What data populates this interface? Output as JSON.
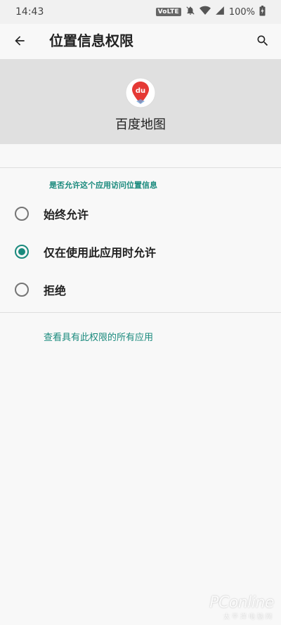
{
  "status_bar": {
    "time": "14:43",
    "network_badge": "VoLTE",
    "battery_percent": "100%",
    "icons": [
      "mute-icon",
      "wifi-icon",
      "signal-icon",
      "battery-charging-icon"
    ]
  },
  "app_bar": {
    "title": "位置信息权限",
    "back_icon": "arrow-left-icon",
    "search_icon": "search-icon"
  },
  "app_info": {
    "name": "百度地图",
    "logo_text": "du",
    "logo_color": "#e53935"
  },
  "permission": {
    "question": "是否允许这个应用访问位置信息",
    "options": [
      {
        "label": "始终允许",
        "selected": false
      },
      {
        "label": "仅在使用此应用时允许",
        "selected": true
      },
      {
        "label": "拒绝",
        "selected": false
      }
    ],
    "see_all_link": "查看具有此权限的所有应用"
  },
  "watermark": {
    "brand": "PConline",
    "sub": "太平洋电脑网"
  },
  "colors": {
    "accent": "#1a8a7d",
    "header_bg": "#e0e0e0"
  }
}
